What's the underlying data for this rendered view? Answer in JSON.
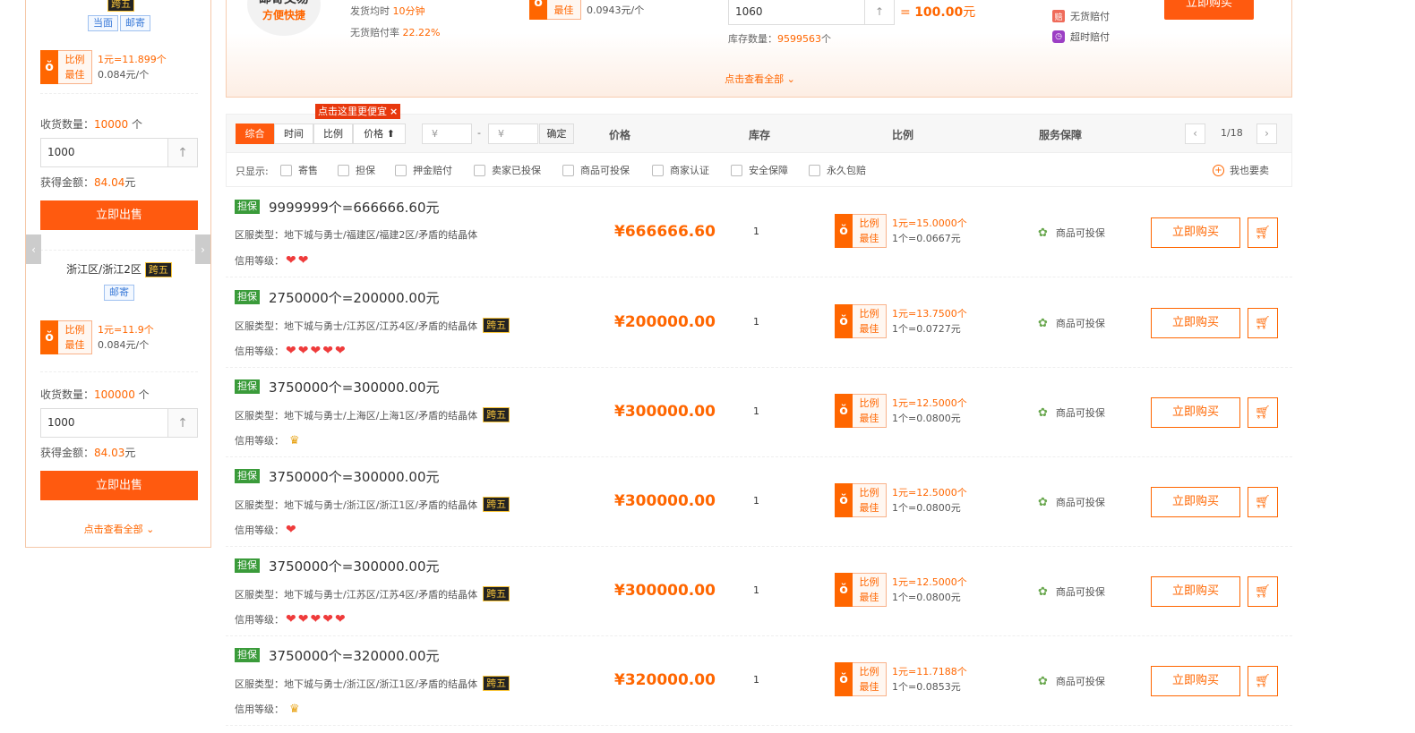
{
  "left_panel": {
    "top_tag": "跨五",
    "card1": {
      "chip1": "当面",
      "chip2": "邮寄",
      "badge_line1": "比例",
      "badge_line2": "最佳",
      "ratio_main": "1元=11.899个",
      "ratio_sub": "0.084元/个",
      "qty_label": "收货数量：",
      "qty_value": "10000",
      "qty_unit": "个",
      "input_value": "1000",
      "amount_label": "获得金额：",
      "amount_value": "84.04",
      "amount_unit": "元",
      "sell_label": "立即出售"
    },
    "card2": {
      "server": "浙江区/浙江2区",
      "tag": "跨五",
      "chip": "邮寄",
      "badge_line1": "比例",
      "badge_line2": "最佳",
      "ratio_main": "1元=11.9个",
      "ratio_sub": "0.084元/个",
      "qty_label": "收货数量：",
      "qty_value": "100000",
      "qty_unit": "个",
      "input_value": "1000",
      "amount_label": "获得金额：",
      "amount_value": "84.03",
      "amount_unit": "元",
      "sell_label": "立即出售"
    },
    "more_label": "点击查看全部",
    "prev_arrow": "‹",
    "next_arrow": "›"
  },
  "top_card": {
    "logo_line1": "邮寄交易",
    "logo_line2": "方便快捷",
    "ship_label": "发货均时",
    "ship_value": "10分钟",
    "refund_label": "无货赔付率",
    "refund_value": "22.22%",
    "badge_line1": "比例",
    "badge_line2": "最佳",
    "unit_price": "0.0943元/个",
    "input_value": "1060",
    "equals": "=",
    "total_value": "100.00",
    "total_unit": "元",
    "stock_label": "库存数量：",
    "stock_value": "9599563",
    "stock_unit": "个",
    "svc1": "无货赔付",
    "svc2": "超时赔付",
    "svc1_icon": "赔",
    "buy_label": "立即购买",
    "more_label": "点击查看全部"
  },
  "filter": {
    "sort_all": "综合",
    "sort_time": "时间",
    "sort_ratio": "比例",
    "sort_price": "价格",
    "tip": "点击这里更便宜",
    "price_min_ph": "¥",
    "price_max_ph": "¥",
    "dash": "-",
    "confirm": "确定",
    "col_price": "价格",
    "col_stock": "库存",
    "col_ratio": "比例",
    "col_service": "服务保障",
    "page_prev": "‹",
    "page_next": "›",
    "page_info": "1/18",
    "show_label": "只显示:",
    "checks": [
      "寄售",
      "担保",
      "押金赔付",
      "卖家已投保",
      "商品可投保",
      "商家认证",
      "安全保障",
      "永久包赔"
    ],
    "sell_too": "我也要卖"
  },
  "listing_common": {
    "guarantee": "担保",
    "server_label": "区服类型：",
    "credit_label": "信用等级：",
    "cross_tag": "跨五",
    "badge_line1": "比例",
    "badge_line2": "最佳",
    "service": "商品可投保",
    "buy": "立即购买"
  },
  "listings": [
    {
      "title": "9999999个=666666.60元",
      "server": "地下城与勇士/福建区/福建2区/矛盾的结晶体",
      "cross": false,
      "credit_hearts": 2,
      "credit_crown": false,
      "price": "¥666666.60",
      "stock": "1",
      "ratio_main": "1元=15.0000个",
      "ratio_sub": "1个=0.0667元"
    },
    {
      "title": "2750000个=200000.00元",
      "server": "地下城与勇士/江苏区/江苏4区/矛盾的结晶体",
      "cross": true,
      "credit_hearts": 5,
      "credit_crown": false,
      "price": "¥200000.00",
      "stock": "1",
      "ratio_main": "1元=13.7500个",
      "ratio_sub": "1个=0.0727元"
    },
    {
      "title": "3750000个=300000.00元",
      "server": "地下城与勇士/上海区/上海1区/矛盾的结晶体",
      "cross": true,
      "credit_hearts": 0,
      "credit_crown": true,
      "price": "¥300000.00",
      "stock": "1",
      "ratio_main": "1元=12.5000个",
      "ratio_sub": "1个=0.0800元"
    },
    {
      "title": "3750000个=300000.00元",
      "server": "地下城与勇士/浙江区/浙江1区/矛盾的结晶体",
      "cross": true,
      "credit_hearts": 1,
      "credit_crown": false,
      "price": "¥300000.00",
      "stock": "1",
      "ratio_main": "1元=12.5000个",
      "ratio_sub": "1个=0.0800元"
    },
    {
      "title": "3750000个=300000.00元",
      "server": "地下城与勇士/江苏区/江苏4区/矛盾的结晶体",
      "cross": true,
      "credit_hearts": 5,
      "credit_crown": false,
      "price": "¥300000.00",
      "stock": "1",
      "ratio_main": "1元=12.5000个",
      "ratio_sub": "1个=0.0800元"
    },
    {
      "title": "3750000个=320000.00元",
      "server": "地下城与勇士/浙江区/浙江1区/矛盾的结晶体",
      "cross": true,
      "credit_hearts": 0,
      "credit_crown": true,
      "price": "¥320000.00",
      "stock": "1",
      "ratio_main": "1元=11.7188个",
      "ratio_sub": "1个=0.0853元"
    }
  ],
  "colors": {
    "accent": "#ff5a0f",
    "guarantee": "#3a9b3a",
    "heart": "#ef3b3b"
  },
  "icons": {
    "ratio": "ratio-medal-icon",
    "service": "flower-shield-icon",
    "cart": "cart-icon",
    "heart": "heart-icon",
    "crown": "crown-icon"
  }
}
